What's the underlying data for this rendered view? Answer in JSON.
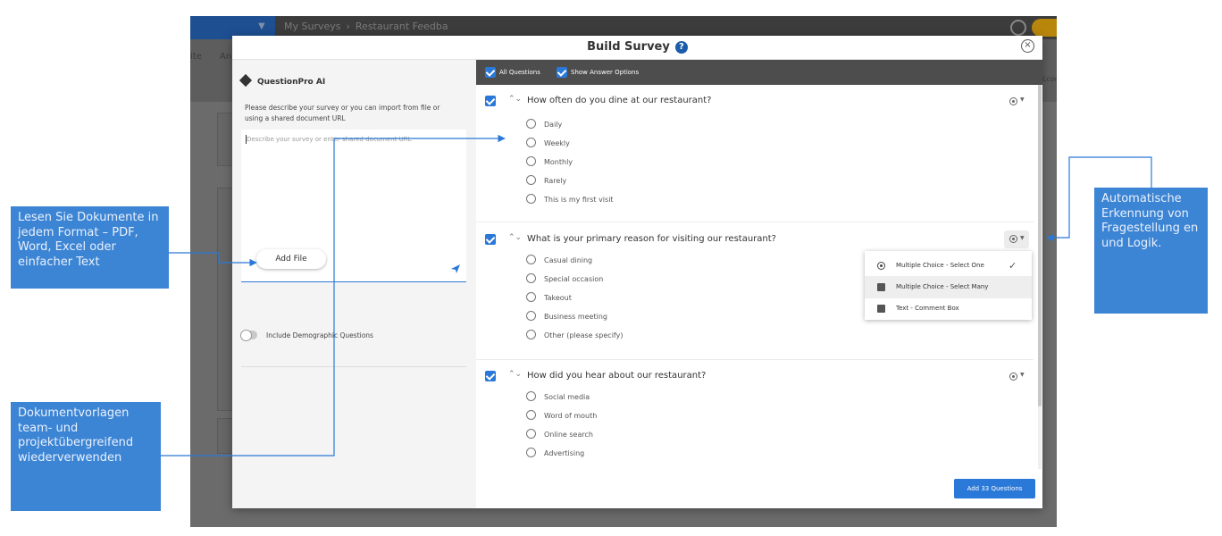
{
  "background_app": {
    "breadcrumb_root": "My Surveys",
    "breadcrumb_sep": "›",
    "breadcrumb_current": "Restaurant Feedba",
    "nav_left_1": "ite",
    "nav_left_2": "Ana",
    "nav_right": "Lcon"
  },
  "modal": {
    "title": "Build Survey",
    "help_icon": "?",
    "close_icon": "×"
  },
  "left_panel": {
    "ai_title": "QuestionPro AI",
    "description": "Please describe your survey or you can import from file or using a shared document URL",
    "prompt_placeholder": "Describe your survey or enter shared document URL",
    "add_file_label": "Add File",
    "demographic_label": "Include Demographic Questions"
  },
  "toolbar": {
    "all_questions": "All Questions",
    "show_answer_options": "Show Answer Options"
  },
  "questions": [
    {
      "text": "How often do you dine at our restaurant?",
      "options": [
        "Daily",
        "Weekly",
        "Monthly",
        "Rarely",
        "This is my first visit"
      ]
    },
    {
      "text": "What is your primary reason for visiting our restaurant?",
      "options": [
        "Casual dining",
        "Special occasion",
        "Takeout",
        "Business meeting",
        "Other (please specify)"
      ]
    },
    {
      "text": "How did you hear about our restaurant?",
      "options": [
        "Social media",
        "Word of mouth",
        "Online search",
        "Advertising"
      ]
    }
  ],
  "question_type_menu": {
    "items": [
      {
        "label": "Multiple Choice - Select One",
        "icon": "radio-icon",
        "selected": true
      },
      {
        "label": "Multiple Choice - Select Many",
        "icon": "multi-select-icon",
        "selected": false
      },
      {
        "label": "Text - Comment Box",
        "icon": "text-box-icon",
        "selected": false
      }
    ],
    "check_glyph": "✓"
  },
  "add_questions_button": "Add 33 Questions",
  "callouts": {
    "documents": "Lesen Sie Dokumente in jedem Format – PDF, Word, Excel oder einfacher Text",
    "templates": "Dokumentvorlagen team- und projektübergreifend wiederverwenden",
    "detection": "Automatische Erkennung von Fragestellung en und Logik."
  },
  "colors": {
    "accent": "#2a78d8",
    "callout": "#3c84d4",
    "toolbar": "#4d4d4d",
    "overlay": "#6b6b6b"
  }
}
